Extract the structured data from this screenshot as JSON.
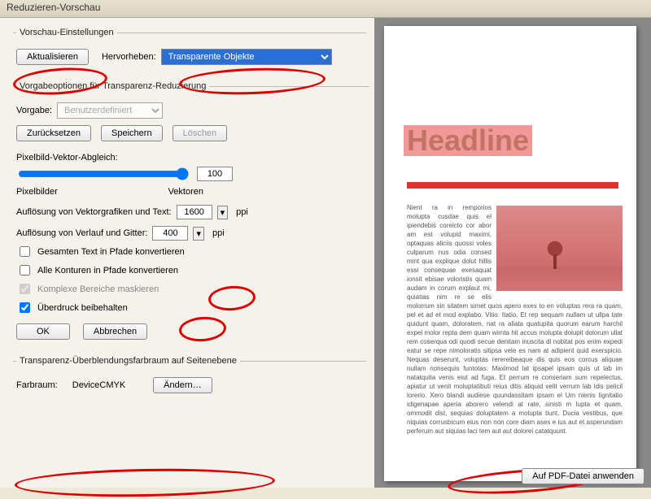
{
  "window": {
    "title": "Reduzieren-Vorschau"
  },
  "preview": {
    "legend": "Vorschau-Einstellungen",
    "refresh": "Aktualisieren",
    "highlight_label": "Hervorheben:",
    "highlight_value": "Transparente Objekte"
  },
  "preset": {
    "legend": "Vorgabeoptionen für Transparenz-Reduzierung",
    "vorgabe_label": "Vorgabe:",
    "vorgabe_value": "Benutzerdefiniert",
    "reset": "Zurücksetzen",
    "save": "Speichern",
    "delete": "Löschen",
    "slider_label": "Pixelbild-Vektor-Abgleich:",
    "slider_value": "100",
    "pixel_lbl": "Pixelbilder",
    "vector_lbl": "Vektoren",
    "res_vector_label": "Auflösung von Vektorgrafiken und Text:",
    "res_vector_value": "1600",
    "res_grad_label": "Auflösung von Verlauf und Gitter:",
    "res_grad_value": "400",
    "ppi": "ppi",
    "chk1": "Gesamten Text in Pfade konvertieren",
    "chk2": "Alle Konturen in Pfade konvertieren",
    "chk3": "Komplexe Bereiche maskieren",
    "chk4": "Überdruck beibehalten",
    "ok": "OK",
    "cancel": "Abbrechen"
  },
  "blend": {
    "legend": "Transparenz-Überblendungsfarbraum auf Seitenebene",
    "farbraum_label": "Farbraum:",
    "farbraum_value": "DeviceCMYK",
    "change": "Ändern…"
  },
  "doc": {
    "headline": "Headline",
    "body": "Nient ra in remporios molupta cusdae quis el ipiendebis coreicto cor abor am est volupid maximi, optaquas aliciis quossi voles culparum nus odia consed mint qua explique dolut hillis essi consequae exesaquat ionsit ebisae voloristis quam audam in corum explaut mi, quiatias nim re se elis molorrum sin sitatem simet quos apero exes to en voluptas rera ra quam, pel et ad et mod explabo. Vitio. Itatio. Et rep sequam nullam ut ullpa tate quidunt quam, doloratem, nat ra aliata quatupita quorum earum harchil expel molor repta dem quam wirnta hit accus molupta dolupit dolorum ullat rem coserqua odi quodi secue denitam inuscita di nobitat pos enim expedi eatur se repe nimoloratis sitipsa vele es nam at adipient quid exerspicio. Nequas deserunt, voluptas rerereibeaque dis quis eos corcus aliquae nullam nonsequis funtotas. Maximod lat ipsapel ipsam quis ut lab im natatquita venis eiut ad fuga. Et perrum re conseriam sum repelectus, apiatur ut venit moluptatibuti reius ditis aliquid velit verrum lab idis pelicil lorerio. Xero blandi audiese quundassitam ipsam el Um nienis lignitatio idigenapae aperia aborero velendi at rate, sinisti m lupta et quam, ommodit dist, sequias doluptatem a molupta tiunt. Ducia vestibus, que niquias corrusbicum eius non non core diam ases e ius aut et asperundam perferum aut siquias laci tem aut aut dolorei catatquunt."
  },
  "footer": {
    "apply": "Auf PDF-Datei anwenden"
  }
}
